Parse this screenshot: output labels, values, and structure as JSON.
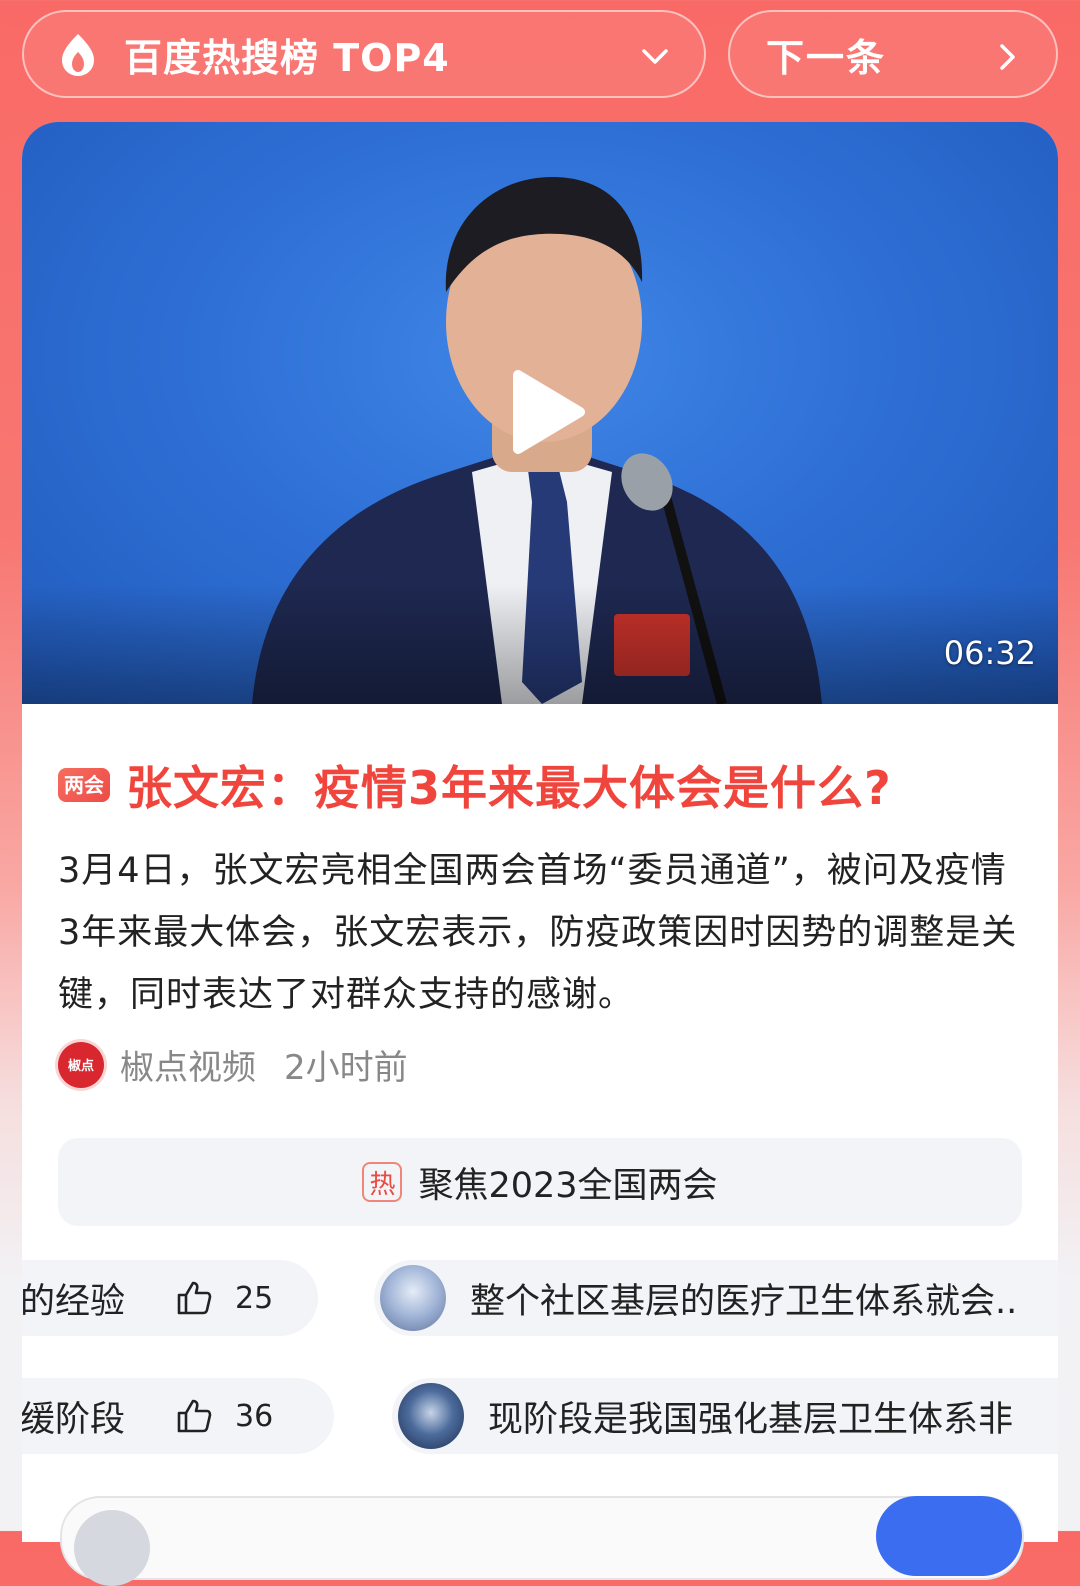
{
  "header": {
    "hot_list_label": "百度热搜榜 TOP4",
    "next_label": "下一条"
  },
  "video": {
    "duration": "06:32"
  },
  "article": {
    "badge": "两会",
    "title": "张文宏：疫情3年来最大体会是什么?",
    "summary": "3月4日，张文宏亮相全国两会首场“委员通道”，被问及疫情3年来最大体会，张文宏表示，防疫政策因时因势的调整是关键，同时表达了对群众支持的感谢。",
    "source_avatar_text": "椒点",
    "source": "椒点视频",
    "time": "2小时前"
  },
  "topic": {
    "tag": "热",
    "label": "聚焦2023全国两会"
  },
  "comments": [
    {
      "left_text": "的经验",
      "likes": "25",
      "text": "整个社区基层的医疗卫生体系就会.."
    },
    {
      "left_text": "缓阶段",
      "likes": "36",
      "text": "现阶段是我国强化基层卫生体系非"
    }
  ],
  "colors": {
    "accent_red": "#f0453c",
    "header_gradient_top": "#f96a66",
    "video_blue": "#2f70d6",
    "button_blue": "#3a6df0"
  }
}
